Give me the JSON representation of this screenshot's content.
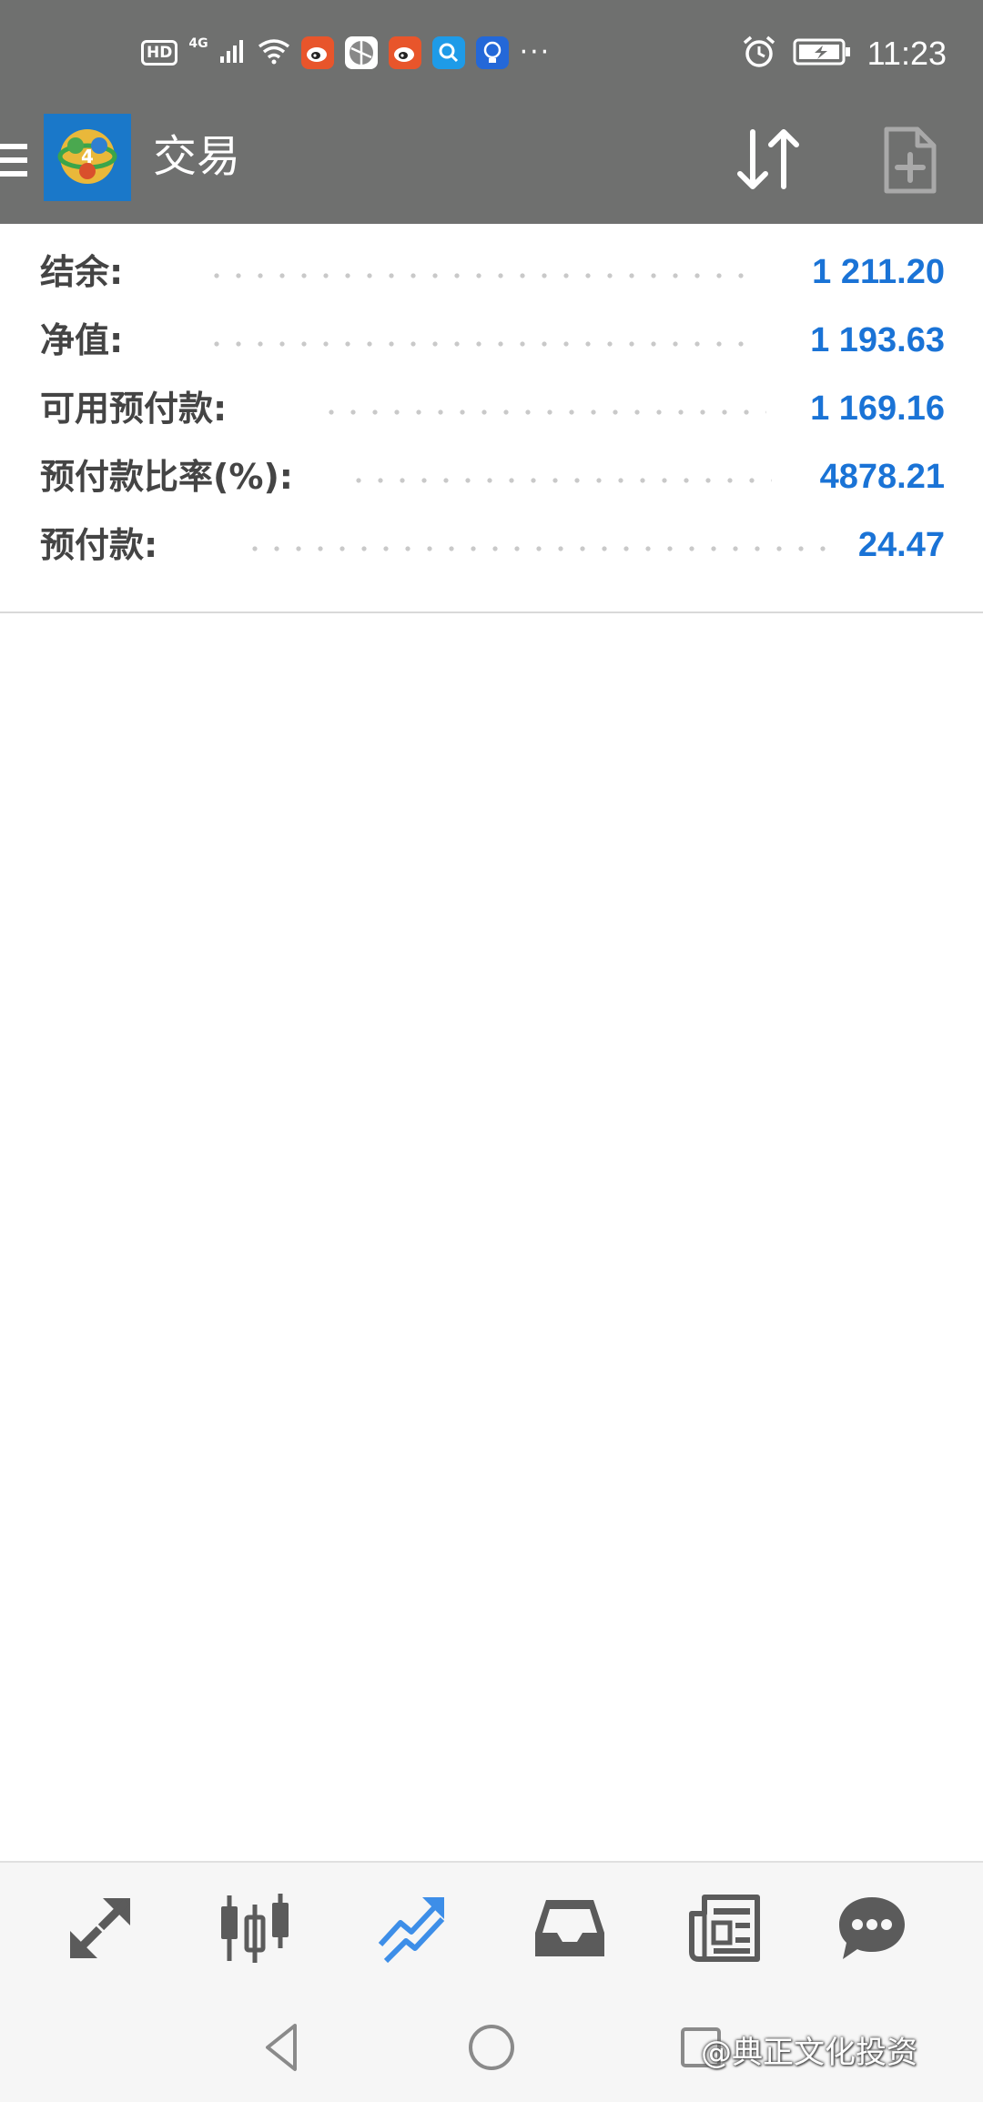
{
  "status_bar": {
    "hd_badge": "HD",
    "network": "4G",
    "more": "···",
    "time": "11:23",
    "app_icons": [
      "weibo-icon",
      "browser-icon",
      "weibo-icon",
      "search-icon",
      "bulb-icon"
    ]
  },
  "app_bar": {
    "title": "交易",
    "logo_label": "4"
  },
  "account": {
    "rows": [
      {
        "label": "结余:",
        "value": "1 211.20"
      },
      {
        "label": "净值:",
        "value": "1 193.63"
      },
      {
        "label": "可用预付款:",
        "value": "1 169.16"
      },
      {
        "label": "预付款比率(%):",
        "value": "4878.21"
      },
      {
        "label": "预付款:",
        "value": "24.47"
      }
    ]
  },
  "bottom_nav": {
    "items": [
      "quotes-icon",
      "chart-icon",
      "trade-icon",
      "history-icon",
      "news-icon",
      "messages-icon"
    ],
    "active": "trade-icon"
  },
  "watermark": "@典正文化投资",
  "colors": {
    "header_bg": "#6f706f",
    "value_blue": "#1a73d6",
    "nav_icon": "#5b5b5b",
    "nav_active": "#3d8ee8"
  }
}
